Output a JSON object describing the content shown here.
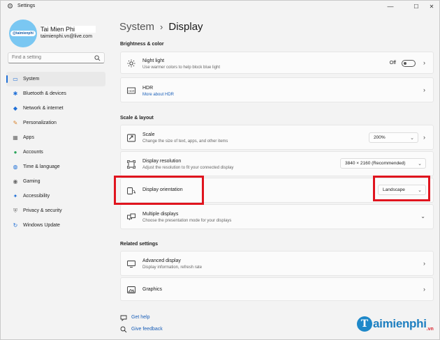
{
  "window": {
    "title": "Settings",
    "controls": {
      "minimize": "—",
      "maximize": "☐",
      "close": "✕"
    }
  },
  "user": {
    "name": "Tai Mien Phi",
    "email": "taimienphi.vn@live.com",
    "avatar_text": "@taimienphi"
  },
  "search": {
    "placeholder": "Find a setting"
  },
  "sidebar": {
    "items": [
      {
        "label": "System",
        "icon": "system-icon",
        "color": "#1f6fd6",
        "glyph": "▭"
      },
      {
        "label": "Bluetooth & devices",
        "icon": "bluetooth-icon",
        "color": "#1f6fd6",
        "glyph": "✱"
      },
      {
        "label": "Network & internet",
        "icon": "network-icon",
        "color": "#1f6fd6",
        "glyph": "◆"
      },
      {
        "label": "Personalization",
        "icon": "brush-icon",
        "color": "#d9822b",
        "glyph": "✎"
      },
      {
        "label": "Apps",
        "icon": "apps-icon",
        "color": "#6b6b6b",
        "glyph": "▦"
      },
      {
        "label": "Accounts",
        "icon": "accounts-icon",
        "color": "#2aa35a",
        "glyph": "●"
      },
      {
        "label": "Time & language",
        "icon": "globe-clock-icon",
        "color": "#1f6fd6",
        "glyph": "◍"
      },
      {
        "label": "Gaming",
        "icon": "gaming-icon",
        "color": "#6b6b6b",
        "glyph": "◉"
      },
      {
        "label": "Accessibility",
        "icon": "accessibility-icon",
        "color": "#1f6fd6",
        "glyph": "✦"
      },
      {
        "label": "Privacy & security",
        "icon": "shield-icon",
        "color": "#7a7a7a",
        "glyph": "⛨"
      },
      {
        "label": "Windows Update",
        "icon": "windows-update-icon",
        "color": "#1f6fd6",
        "glyph": "↻"
      }
    ]
  },
  "breadcrumb": {
    "parent": "System",
    "separator": "›",
    "current": "Display"
  },
  "sections": {
    "brightness": "Brightness & color",
    "scale_layout": "Scale & layout",
    "related": "Related settings"
  },
  "settings": {
    "night_light": {
      "title": "Night light",
      "subtitle": "Use warmer colors to help block blue light",
      "state": "Off"
    },
    "hdr": {
      "title": "HDR",
      "link": "More about HDR"
    },
    "scale": {
      "title": "Scale",
      "subtitle": "Change the size of text, apps, and other items",
      "value": "200%"
    },
    "resolution": {
      "title": "Display resolution",
      "subtitle": "Adjust the resolution to fit your connected display",
      "value": "3840 × 2160 (Recommended)"
    },
    "orientation": {
      "title": "Display orientation",
      "value": "Landscape"
    },
    "multiple": {
      "title": "Multiple displays",
      "subtitle": "Choose the presentation mode for your displays"
    },
    "advanced": {
      "title": "Advanced display",
      "subtitle": "Display information, refresh rate"
    },
    "graphics": {
      "title": "Graphics"
    }
  },
  "help": {
    "get_help": "Get help",
    "feedback": "Give feedback"
  },
  "watermark": {
    "initial": "T",
    "name": "aimienphi",
    "suffix": ".vn"
  },
  "colors": {
    "accent": "#1f6fd6",
    "highlight": "#e0141e",
    "link": "#1a5fb8"
  }
}
